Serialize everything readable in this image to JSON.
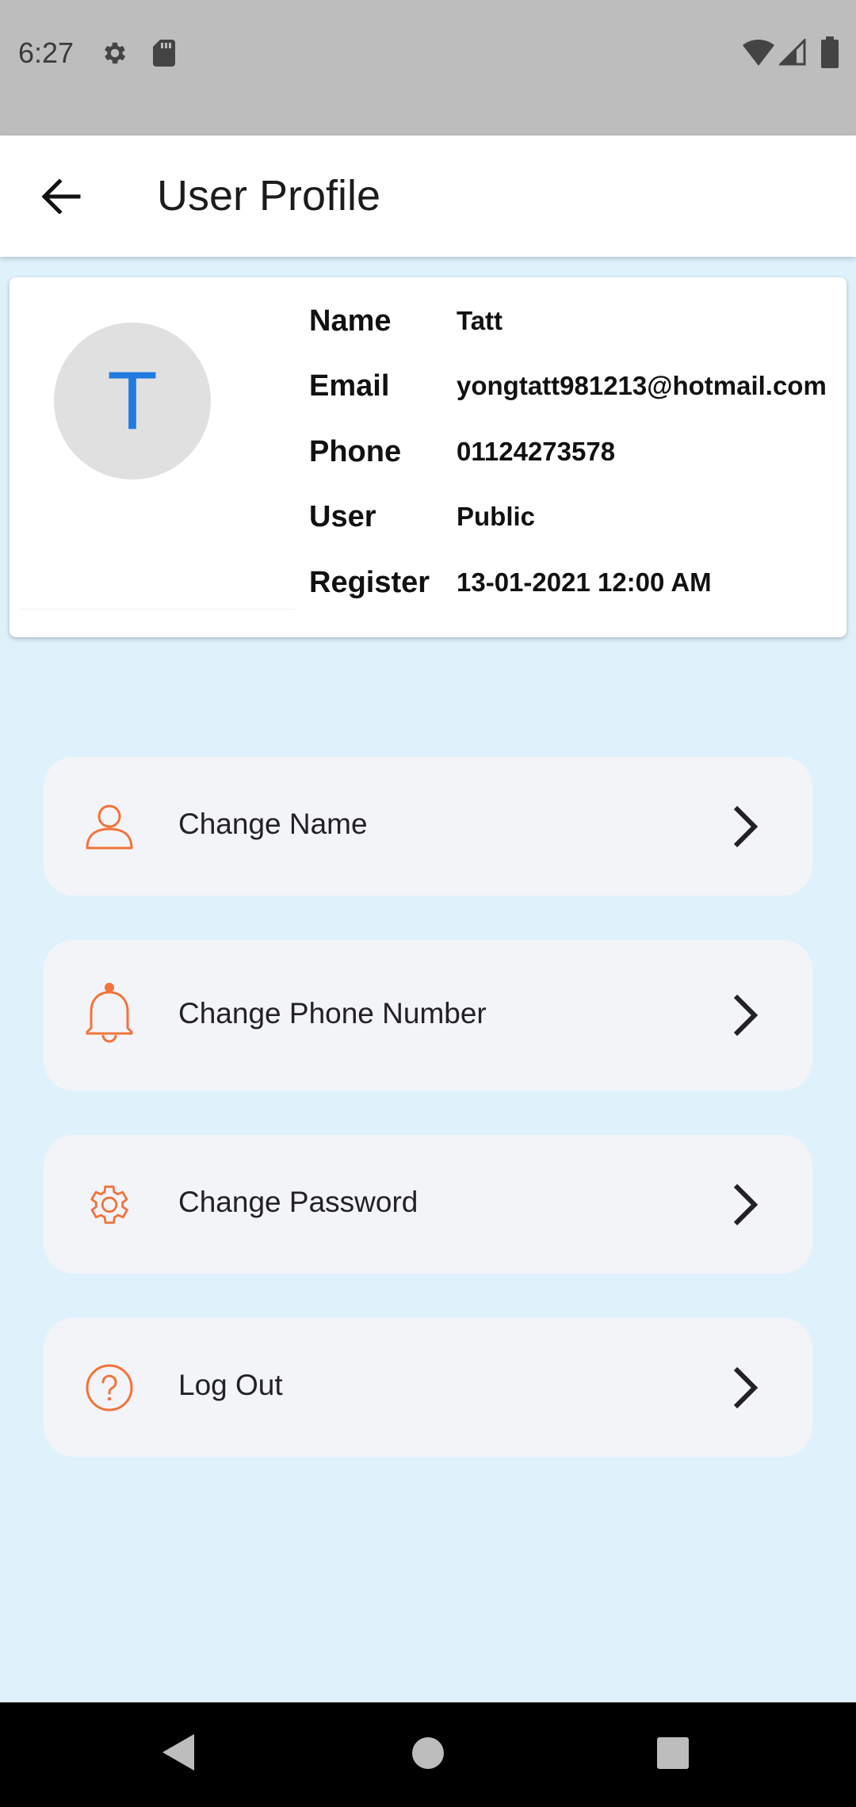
{
  "status_bar": {
    "time": "6:27",
    "icons_left": [
      "gear-icon",
      "sd-card-icon"
    ],
    "icons_right": [
      "wifi-icon",
      "signal-icon",
      "battery-icon"
    ]
  },
  "app_bar": {
    "back_icon": "arrow-back-icon",
    "title": "User Profile"
  },
  "profile": {
    "avatar_letter": "T",
    "avatar_color": "#1e7be0",
    "rows": [
      {
        "label": "Name",
        "value": "Tatt"
      },
      {
        "label": "Email",
        "value": "yongtatt981213@hotmail.com"
      },
      {
        "label": "Phone",
        "value": "01124273578"
      },
      {
        "label": "User",
        "value": "Public"
      },
      {
        "label": "Register",
        "value": "13-01-2021 12:00 AM"
      }
    ]
  },
  "menu": {
    "accent_color": "#f2733b",
    "items": [
      {
        "label": "Change Name",
        "icon": "user-icon"
      },
      {
        "label": "Change Phone Number",
        "icon": "bell-icon"
      },
      {
        "label": "Change Password",
        "icon": "gear-icon"
      },
      {
        "label": "Log Out",
        "icon": "help-circle-icon"
      }
    ]
  },
  "nav_bar": {
    "buttons": [
      "back-triangle-icon",
      "home-circle-icon",
      "recents-square-icon"
    ]
  }
}
